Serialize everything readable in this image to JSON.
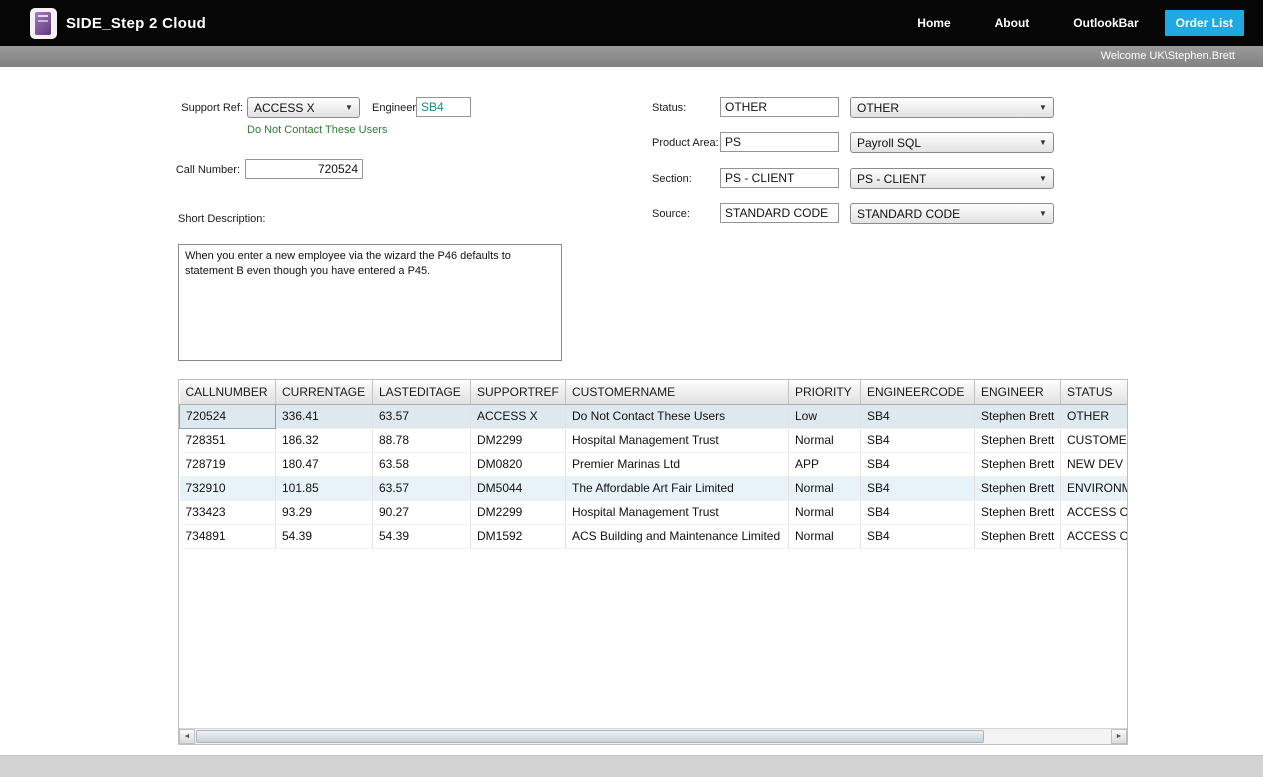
{
  "header": {
    "title": "SIDE_Step 2 Cloud",
    "nav": [
      {
        "label": "Home"
      },
      {
        "label": "About"
      },
      {
        "label": "OutlookBar"
      },
      {
        "label": "Order List"
      }
    ],
    "welcome": "Welcome UK\\Stephen.Brett",
    "accent_color": "#1fa9e2"
  },
  "form": {
    "support_ref": {
      "label": "Support Ref:",
      "value": "ACCESS X"
    },
    "engineer": {
      "label": "Engineer:",
      "value": "SB4"
    },
    "contact_link": "Do Not Contact These Users",
    "call_number": {
      "label": "Call Number:",
      "value": "720524"
    },
    "short_description": {
      "label": "Short Description:",
      "value": "When you enter a new employee via the wizard the P46 defaults to statement B even though you have entered a P45."
    },
    "status": {
      "label": "Status:",
      "value": "OTHER",
      "selected": "OTHER"
    },
    "product_area": {
      "label": "Product Area:",
      "value": "PS",
      "selected": "Payroll SQL"
    },
    "section": {
      "label": "Section:",
      "value": "PS - CLIENT",
      "selected": "PS - CLIENT"
    },
    "source": {
      "label": "Source:",
      "value": "STANDARD CODE",
      "selected": "STANDARD CODE"
    }
  },
  "grid": {
    "columns": [
      "CALLNUMBER",
      "CURRENTAGE",
      "LASTEDITAGE",
      "SUPPORTREF",
      "CUSTOMERNAME",
      "PRIORITY",
      "ENGINEERCODE",
      "ENGINEER",
      "STATUS"
    ],
    "rows": [
      [
        "720524",
        "336.41",
        "63.57",
        "ACCESS X",
        "Do Not Contact These Users",
        "Low",
        "SB4",
        "Stephen Brett",
        "OTHER"
      ],
      [
        "728351",
        "186.32",
        "88.78",
        "DM2299",
        "Hospital Management Trust",
        "Normal",
        "SB4",
        "Stephen Brett",
        "CUSTOMER I"
      ],
      [
        "728719",
        "180.47",
        "63.58",
        "DM0820",
        "Premier Marinas Ltd",
        "APP",
        "SB4",
        "Stephen Brett",
        "NEW DEV IS"
      ],
      [
        "732910",
        "101.85",
        "63.57",
        "DM5044",
        "The Affordable Art Fair Limited",
        "Normal",
        "SB4",
        "Stephen Brett",
        "ENVIRONME"
      ],
      [
        "733423",
        "93.29",
        "90.27",
        "DM2299",
        "Hospital Management Trust",
        "Normal",
        "SB4",
        "Stephen Brett",
        "ACCESS OS"
      ],
      [
        "734891",
        "54.39",
        "54.39",
        "DM1592",
        "ACS Building and Maintenance Limited",
        "Normal",
        "SB4",
        "Stephen Brett",
        "ACCESS OS"
      ]
    ],
    "selected_row_index": 0,
    "highlighted_rows": [
      3
    ],
    "scroll": {
      "left_arrow": "◄",
      "right_arrow": "►"
    }
  },
  "icons": {
    "dropdown_arrow": "▼"
  }
}
